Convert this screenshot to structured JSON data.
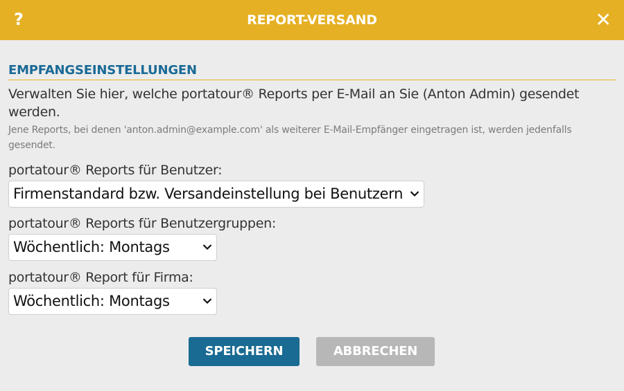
{
  "header": {
    "help_label": "?",
    "title": "REPORT-VERSAND",
    "close_label": "✕"
  },
  "section": {
    "heading": "EMPFANGSEINSTELLUNGEN",
    "intro": "Verwalten Sie hier, welche portatour® Reports per E-Mail an Sie (Anton Admin) gesendet werden.",
    "note": "Jene Reports, bei denen 'anton.admin@example.com' als weiterer E-Mail-Empfänger eingetragen ist, werden jedenfalls gesendet."
  },
  "fields": [
    {
      "label": "portatour® Reports für Benutzer:",
      "value": "Firmenstandard bzw. Versandeinstellung bei Benutzern"
    },
    {
      "label": "portatour® Reports für Benutzergruppen:",
      "value": "Wöchentlich: Montags"
    },
    {
      "label": "portatour® Report für Firma:",
      "value": "Wöchentlich: Montags"
    }
  ],
  "buttons": {
    "save": "SPEICHERN",
    "cancel": "ABBRECHEN"
  },
  "colors": {
    "header_bg": "#e5b023",
    "heading": "#1a6a96",
    "primary_button": "#1a6b93",
    "secondary_button": "#b7b7b7"
  },
  "icons": {
    "help": "question-mark-icon",
    "close": "close-icon",
    "dropdown": "chevron-down-icon"
  }
}
